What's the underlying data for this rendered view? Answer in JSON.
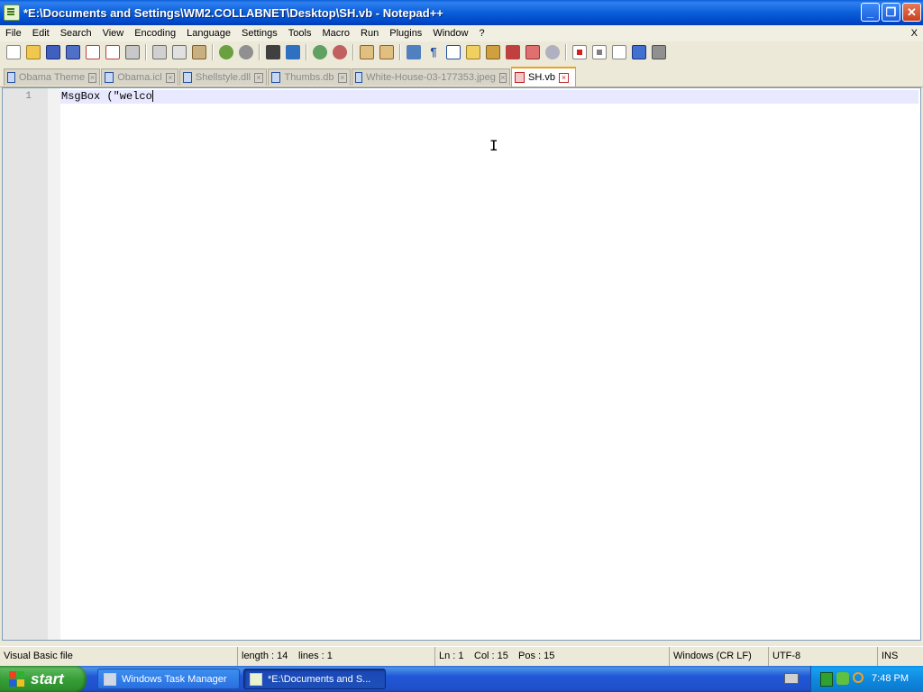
{
  "window": {
    "title": "*E:\\Documents and Settings\\WM2.COLLABNET\\Desktop\\SH.vb - Notepad++",
    "buttons": {
      "minimize": "_",
      "restore": "❐",
      "close": "✕"
    }
  },
  "menubar": {
    "items": [
      "File",
      "Edit",
      "Search",
      "View",
      "Encoding",
      "Language",
      "Settings",
      "Tools",
      "Macro",
      "Run",
      "Plugins",
      "Window",
      "?"
    ],
    "close_label": "X"
  },
  "toolbar": {
    "icons": [
      "new-file-icon",
      "open-file-icon",
      "save-icon",
      "save-all-icon",
      "close-icon",
      "close-all-icon",
      "print-icon",
      "cut-icon",
      "copy-icon",
      "paste-icon",
      "undo-icon",
      "redo-icon",
      "find-icon",
      "replace-icon",
      "zoom-in-icon",
      "zoom-out-icon",
      "sync-vertical-icon",
      "sync-horizontal-icon",
      "word-wrap-icon",
      "show-all-chars-icon",
      "indent-guide-icon",
      "user-defined-lang-icon",
      "doc-map-icon",
      "function-list-icon",
      "folder-workspace-icon",
      "monitor-icon",
      "record-macro-icon",
      "stop-record-icon",
      "play-macro-icon",
      "run-multiple-icon",
      "save-macro-icon"
    ]
  },
  "tabs": [
    {
      "label": "Obama Theme",
      "active": false
    },
    {
      "label": "Obama.icl",
      "active": false
    },
    {
      "label": "Shellstyle.dll",
      "active": false
    },
    {
      "label": "Thumbs.db",
      "active": false
    },
    {
      "label": "White-House-03-177353.jpeg",
      "active": false
    },
    {
      "label": "SH.vb",
      "active": true
    }
  ],
  "editor": {
    "line_number": "1",
    "code": "MsgBox (\"welco"
  },
  "statusbar": {
    "language": "Visual Basic file",
    "length": "length : 14",
    "lines": "lines : 1",
    "ln": "Ln : 1",
    "col": "Col : 15",
    "pos": "Pos : 15",
    "eol": "Windows (CR LF)",
    "encoding": "UTF-8",
    "mode": "INS"
  },
  "taskbar": {
    "start_label": "start",
    "tasks": [
      {
        "label": "Windows Task Manager",
        "active": false
      },
      {
        "label": "*E:\\Documents and S...",
        "active": true
      }
    ],
    "clock": "7:48 PM"
  },
  "colors": {
    "titlebar": "#0a5fd8",
    "active_tab_accent": "#f0a020",
    "current_line": "#e8e8ff",
    "start_button": "#37a037"
  }
}
